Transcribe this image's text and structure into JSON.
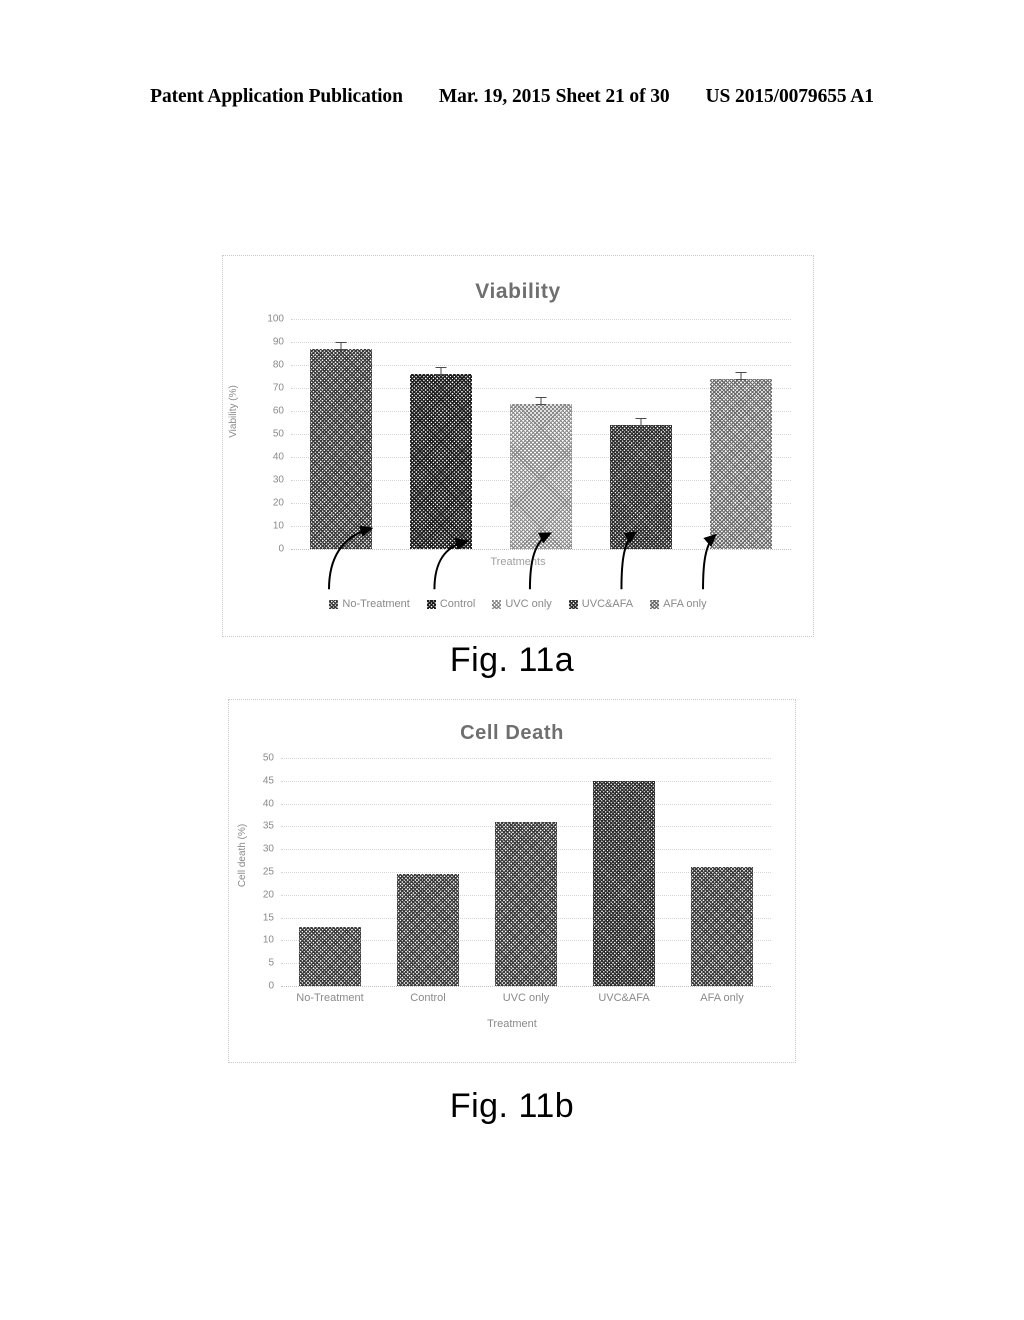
{
  "header": {
    "publication": "Patent Application Publication",
    "date": "Mar. 19, 2015",
    "sheet": "Sheet 21 of 30",
    "number": "US 2015/0079655 A1"
  },
  "figures": [
    {
      "caption": "Fig. 11a"
    },
    {
      "caption": "Fig. 11b"
    }
  ],
  "legend_note": "Arrows link each legend entry to its corresponding bar.",
  "chart_data": [
    {
      "type": "bar",
      "title": "Viability",
      "xlabel": "Treatments",
      "ylabel": "Viability (%)",
      "categories": [
        "No-Treatment",
        "Control",
        "UVC only",
        "UVC&AFA",
        "AFA only"
      ],
      "values": [
        87,
        76,
        63,
        54,
        74
      ],
      "error_bars": [
        1.5,
        1.5,
        1.5,
        1.5,
        1.5
      ],
      "ylim": [
        0,
        100
      ],
      "yticks": [
        0,
        10,
        20,
        30,
        40,
        50,
        60,
        70,
        80,
        90,
        100
      ],
      "grid": true,
      "legend": [
        "No-Treatment",
        "Control",
        "UVC only",
        "UVC&AFA",
        "AFA only"
      ],
      "legend_position": "bottom",
      "xtick_labels_shown": false,
      "bar_colors": [
        "#3a3a3a",
        "#1f1f1f",
        "#878787",
        "#2e2e2e",
        "#6b6b6b"
      ]
    },
    {
      "type": "bar",
      "title": "Cell Death",
      "xlabel": "Treatment",
      "ylabel": "Cell death (%)",
      "categories": [
        "No-Treatment",
        "Control",
        "UVC only",
        "UVC&AFA",
        "AFA only"
      ],
      "values": [
        13,
        24.5,
        36,
        45,
        26
      ],
      "ylim": [
        0,
        50
      ],
      "yticks": [
        0,
        5,
        10,
        15,
        20,
        25,
        30,
        35,
        40,
        45,
        50
      ],
      "grid": true,
      "legend": [],
      "legend_position": "none",
      "xtick_labels_shown": true,
      "bar_colors": [
        "#3a3a3a",
        "#3a3a3a",
        "#3a3a3a",
        "#2e2e2e",
        "#3a3a3a"
      ]
    }
  ]
}
